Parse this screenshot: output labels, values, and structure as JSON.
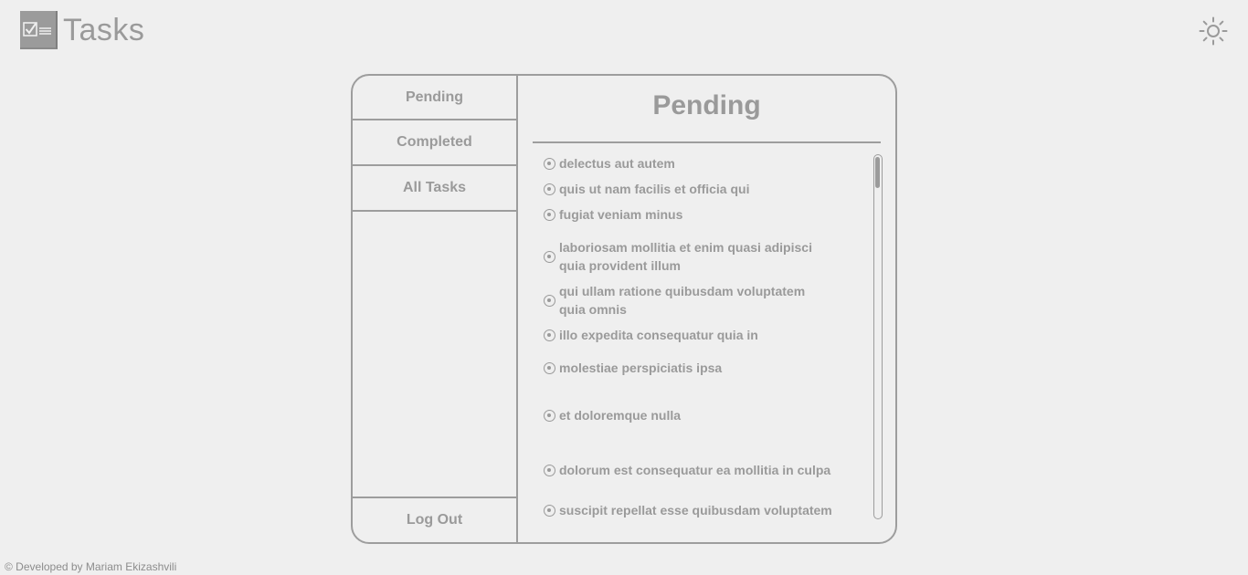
{
  "header": {
    "app_title": "Tasks",
    "logo_icon": "checklist-icon",
    "theme_icon": "sun-icon"
  },
  "sidebar": {
    "items": [
      {
        "label": "Pending"
      },
      {
        "label": "Completed"
      },
      {
        "label": "All Tasks"
      }
    ],
    "logout_label": "Log Out"
  },
  "main": {
    "title": "Pending",
    "tasks": [
      {
        "text": "delectus aut autem"
      },
      {
        "text": "quis ut nam facilis et officia qui"
      },
      {
        "text": "fugiat veniam minus"
      },
      {
        "text": "laboriosam mollitia et enim quasi adipisci quia provident illum"
      },
      {
        "text": "qui ullam ratione quibusdam voluptatem quia omnis"
      },
      {
        "text": "illo expedita consequatur quia in"
      },
      {
        "text": "molestiae perspiciatis ipsa"
      },
      {
        "text": "et doloremque nulla"
      },
      {
        "text": "dolorum est consequatur ea mollitia in culpa"
      },
      {
        "text": "suscipit repellat esse quibusdam voluptatem"
      }
    ]
  },
  "footer": {
    "credit": "© Developed by Mariam Ekizashvili"
  },
  "colors": {
    "background": "#efefef",
    "text": "#9a9a9a",
    "border": "#9d9d9d"
  }
}
